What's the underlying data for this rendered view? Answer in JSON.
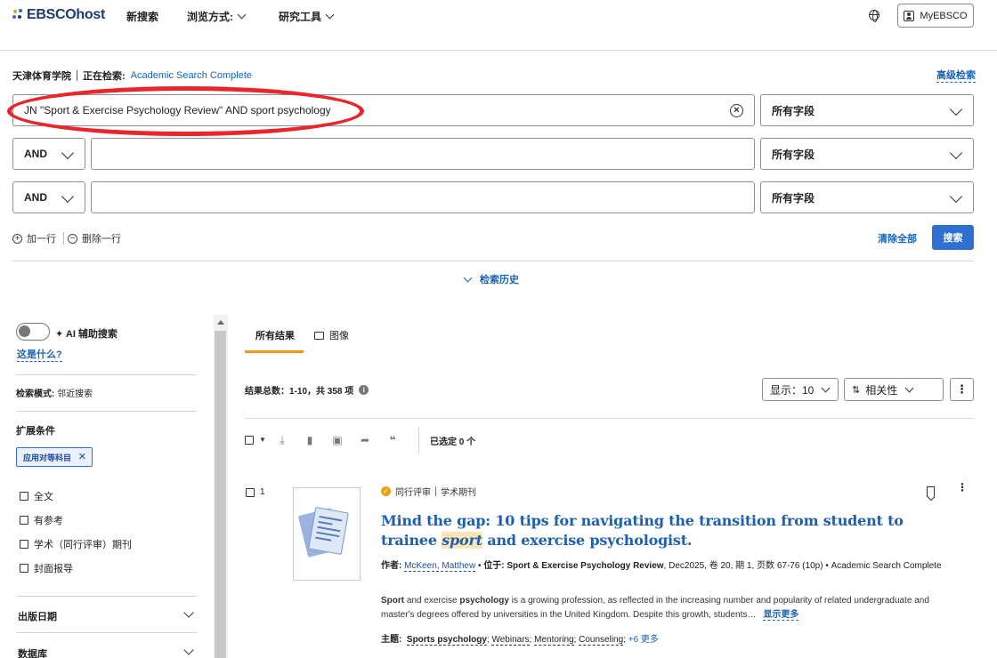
{
  "header": {
    "logo": "EBSCOhost",
    "nav": [
      "新搜索",
      "浏览方式:",
      "研究工具"
    ],
    "myebsco": "MyEBSCO"
  },
  "search": {
    "institution": "天津体育学院",
    "searching_label": "正在检索:",
    "database": "Academic Search Complete",
    "advanced": "高级检索",
    "query": "JN \"Sport & Exercise Psychology Review\" AND sport psychology",
    "field_label": "所有字段",
    "bool_and": "AND",
    "add_row": "加一行",
    "remove_row": "删除一行",
    "clear_all": "清除全部",
    "search_button": "搜索",
    "history": "检索历史"
  },
  "sidebar": {
    "ai_label": "AI 辅助搜索",
    "what_is": "这是什么?",
    "mode_label": "检索模式:",
    "mode_value": "邻近搜索",
    "expand_title": "扩展条件",
    "chip": "应用对等科目",
    "limits": [
      "全文",
      "有参考",
      "学术（同行评审）期刊",
      "封面报导"
    ],
    "accordions": [
      "出版日期",
      "数据库"
    ]
  },
  "results": {
    "tabs": [
      "所有结果",
      "图像"
    ],
    "total": "结果总数：1-10，共 358 项",
    "display": "显示：10",
    "sort": "相关性",
    "selected": "已选定 0 个",
    "item": {
      "index": "1",
      "peer": "同行评审",
      "type": "学术期刊",
      "title_pre": "Mind the gap: 10 tips for navigating the transition from student to trainee",
      "title_hl": "sport",
      "title_post": "and exercise psychologist.",
      "author_label": "作者:",
      "author": "McKeen, Matthew",
      "in_label": "位于:",
      "journal": "Sport & Exercise Psychology Review",
      "citation": ", Dec2025, 卷 20, 期 1, 页数 67-76 (10p) • Academic Search Complete",
      "abstract_b1": "Sport",
      "abstract_t1": " and exercise ",
      "abstract_b2": "psychology",
      "abstract_t2": " is a growing profession, as reflected in the increasing number and popularity of related undergraduate and master's degrees offered by universities in the United Kingdom. Despite this growth, students…",
      "show_more": "显示更多",
      "subjects_label": "主题:",
      "subjects": [
        "Sports psychology",
        "Webinars",
        "Mentoring",
        "Counseling"
      ],
      "subjects_more": "+6 更多"
    }
  }
}
